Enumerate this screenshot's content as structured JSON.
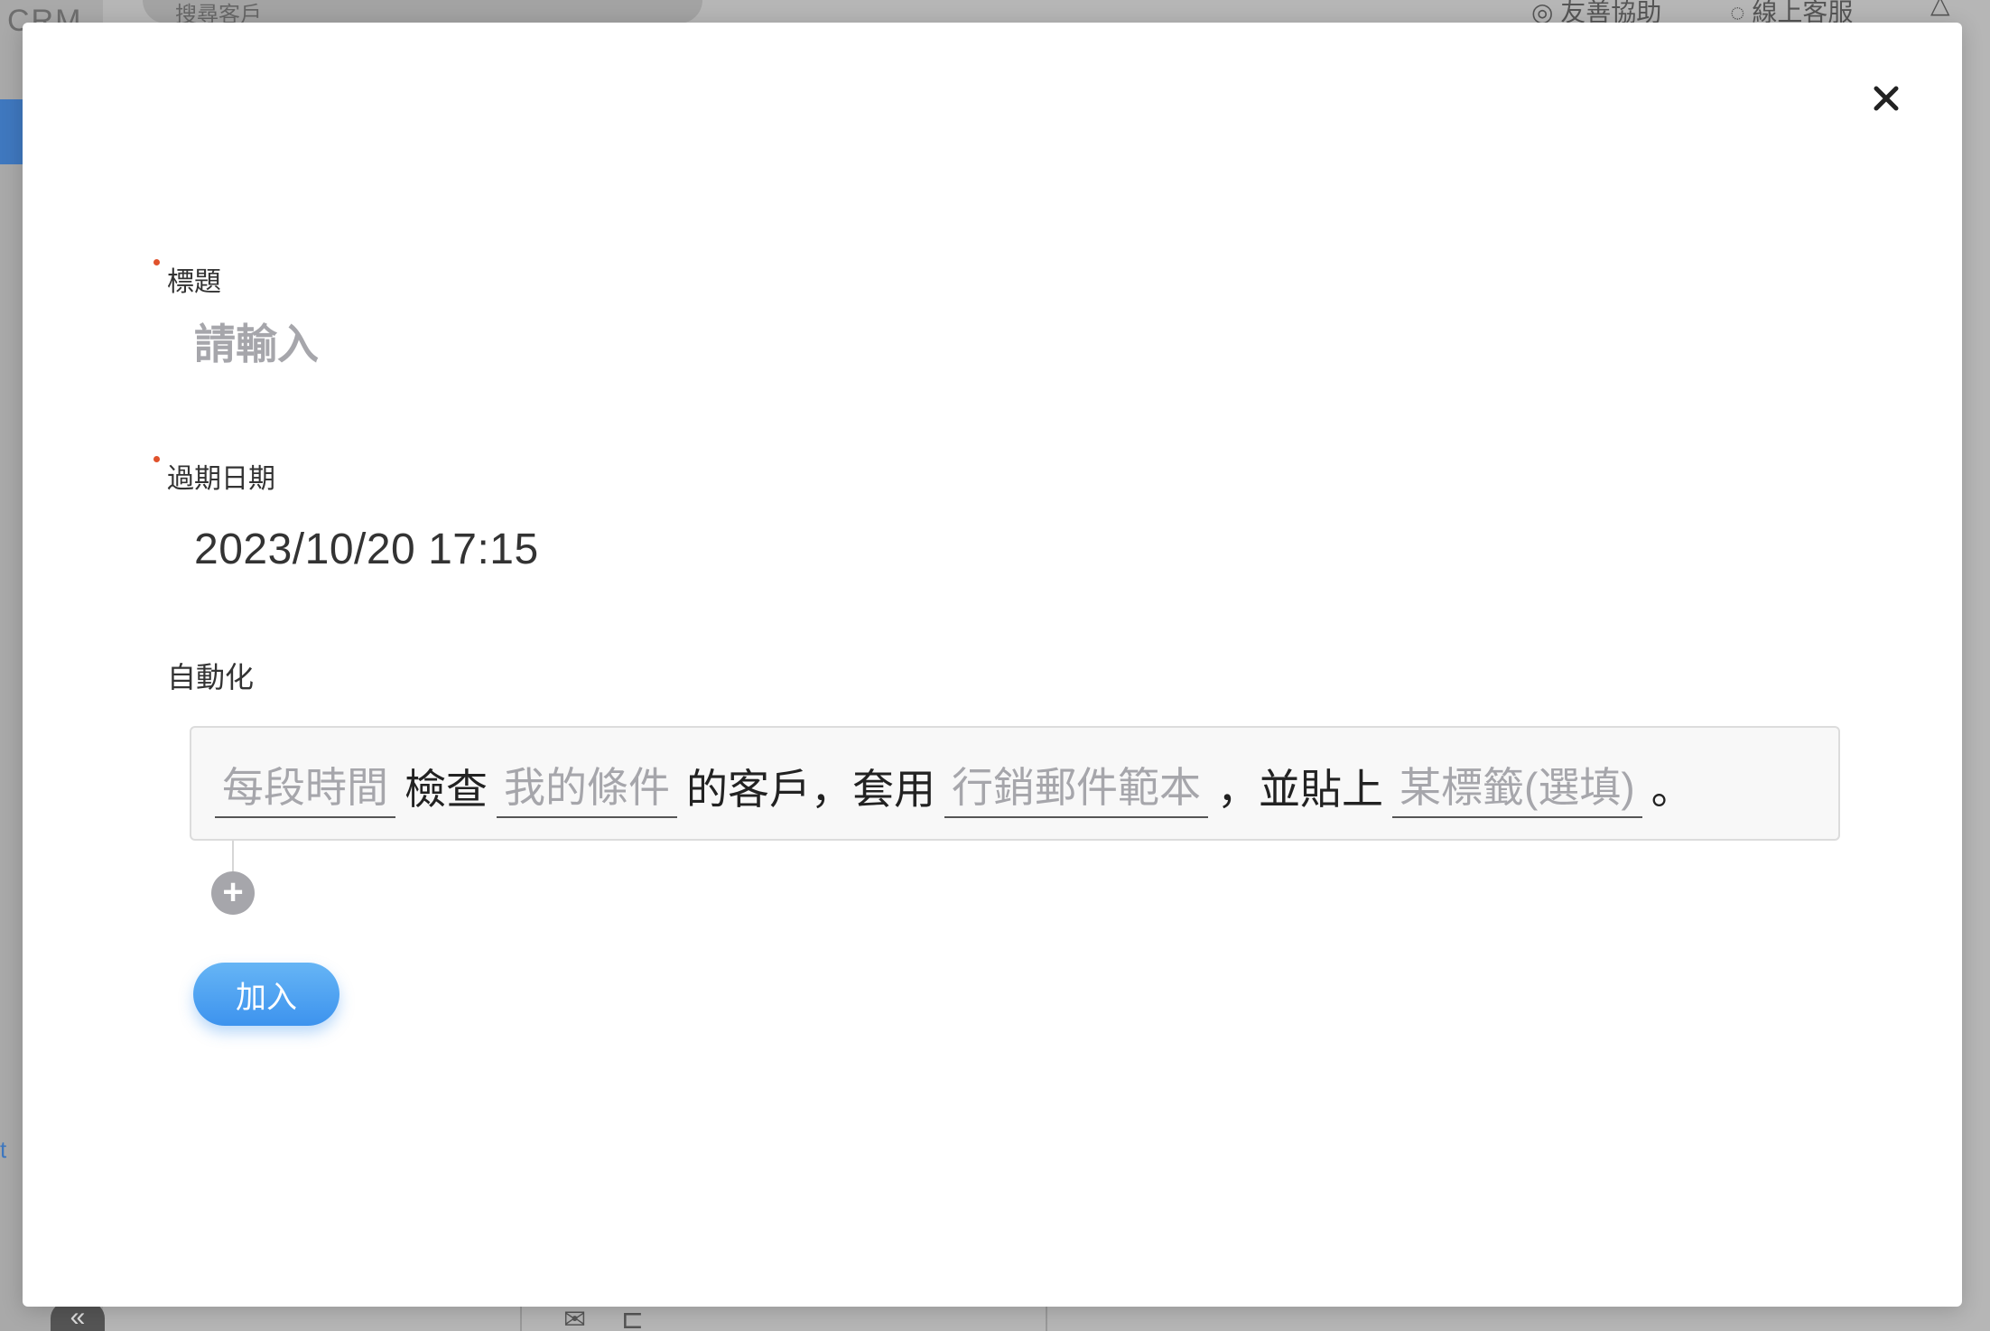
{
  "background": {
    "brand": "CRM",
    "search_placeholder": "搜尋客戶",
    "header_help": "友善協助",
    "header_service": "線上客服",
    "collapse_label": "«",
    "side_link": "t"
  },
  "modal": {
    "title_field": {
      "label": "標題",
      "placeholder": "請輸入",
      "required": true
    },
    "expiry_field": {
      "label": "過期日期",
      "value": "2023/10/20 17:15",
      "required": true
    },
    "automation": {
      "label": "自動化",
      "rule": {
        "slot_frequency": "每段時間",
        "text_check": "檢查",
        "slot_condition": "我的條件",
        "text_customers_apply": "的客戶，套用",
        "slot_template": "行銷郵件範本",
        "text_and_tag": "，並貼上",
        "slot_tag": "某標籤(選填)",
        "text_end": "。"
      }
    },
    "add_rule_label": "+",
    "submit_label": "加入"
  },
  "icons": {
    "close": "close-icon",
    "plus": "plus-icon",
    "search": "search-icon",
    "bell": "bell-icon",
    "mail": "mail-icon",
    "flow": "flow-icon"
  },
  "colors": {
    "required_dot": "#e0522c",
    "primary_button": "#4aa0f0",
    "placeholder": "#a6a6ab"
  }
}
